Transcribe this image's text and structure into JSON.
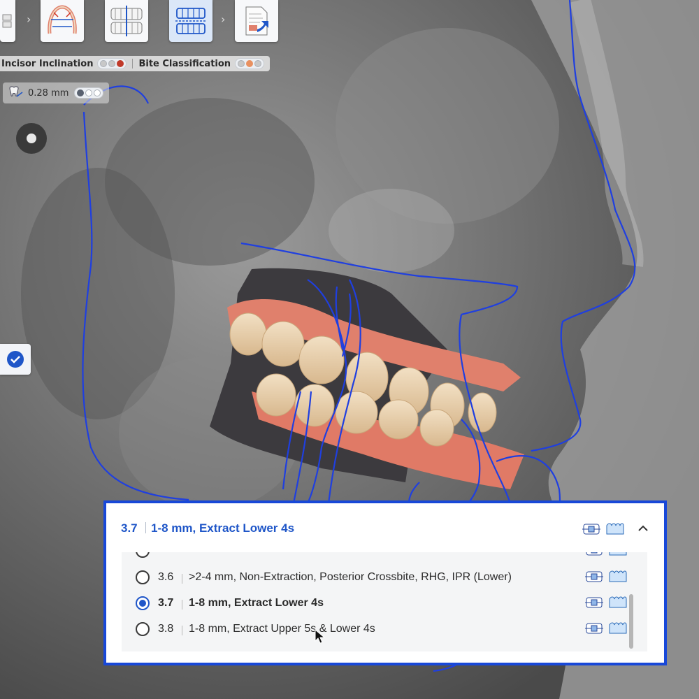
{
  "toolbar": {
    "tools": [
      {
        "name": "mini-tool",
        "active": false
      },
      {
        "name": "arch-measure-tool",
        "active": false
      },
      {
        "name": "dentition-midline-tool",
        "active": false
      },
      {
        "name": "bite-alignment-tool",
        "active": true
      },
      {
        "name": "export-report-tool",
        "active": false
      }
    ]
  },
  "metrics": {
    "incisor_inclination": {
      "label": "Incisor Inclination",
      "dots": [
        "#c8c8c8",
        "#c8c8c8",
        "#c03a2a"
      ]
    },
    "bite_classification": {
      "label": "Bite Classification",
      "dots": [
        "#c8c8c8",
        "#e89060",
        "#c8c8c8"
      ]
    }
  },
  "measurement": {
    "value": "0.28 mm",
    "dots": [
      "#5a6270",
      "#ffffff",
      "#ffffff"
    ]
  },
  "treatment_panel": {
    "selected_code": "3.7",
    "selected_description": "1-8 mm, Extract Lower 4s",
    "options": [
      {
        "code": "3.6",
        "description": ">2-4 mm, Non-Extraction, Posterior Crossbite, RHG, IPR (Lower)",
        "selected": false
      },
      {
        "code": "3.7",
        "description": "1-8 mm, Extract Lower 4s",
        "selected": true
      },
      {
        "code": "3.8",
        "description": "1-8 mm, Extract Upper 5s & Lower 4s",
        "selected": false
      }
    ]
  },
  "colors": {
    "accent": "#1f56c8",
    "panel_border": "#1848d8",
    "trace": "#1f3fe0",
    "gingiva": "#e0806c"
  }
}
